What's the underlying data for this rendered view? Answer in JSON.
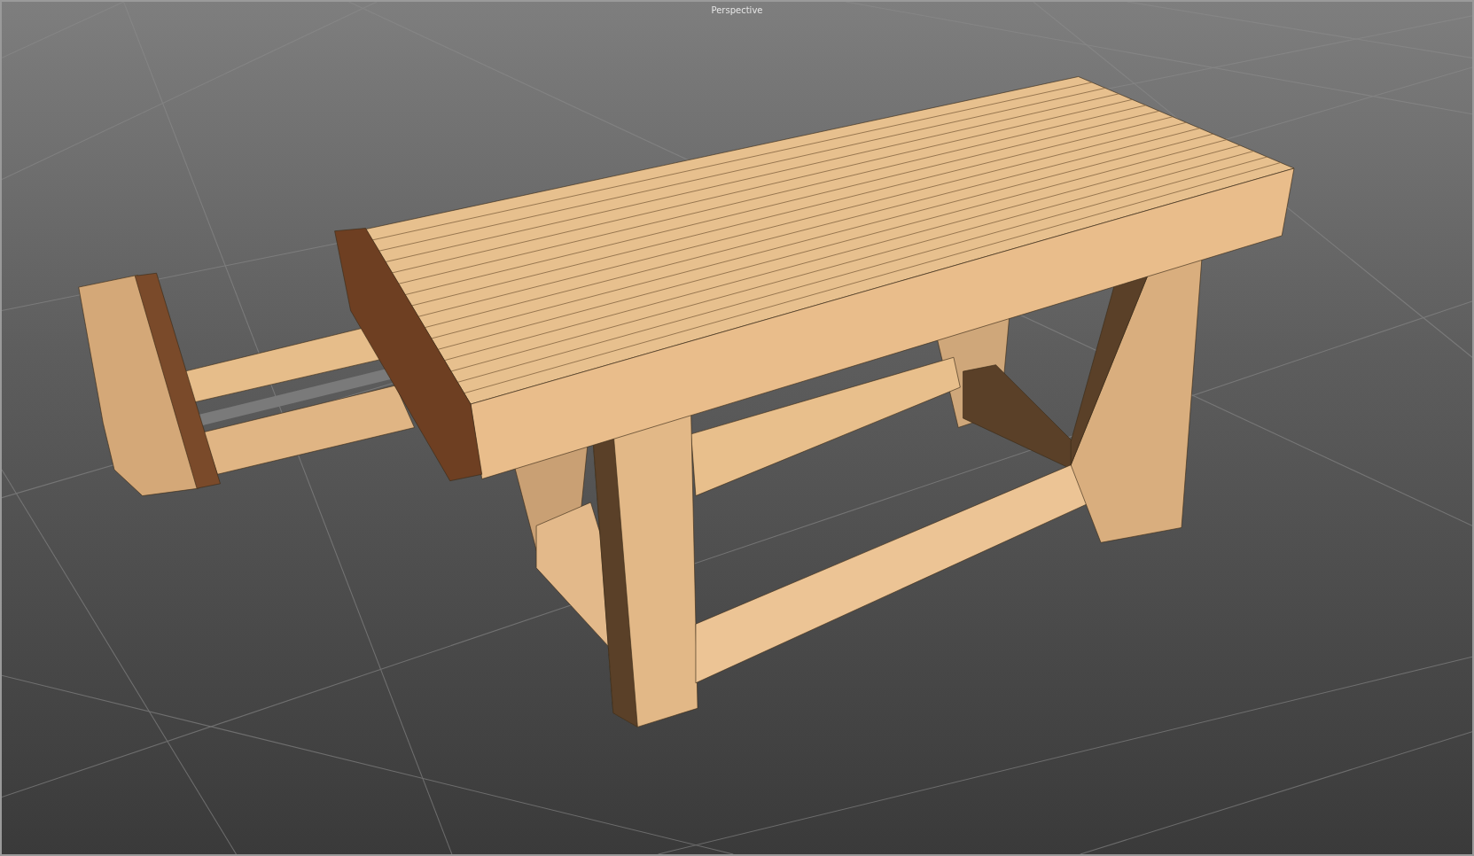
{
  "viewport": {
    "title": "Perspective"
  }
}
